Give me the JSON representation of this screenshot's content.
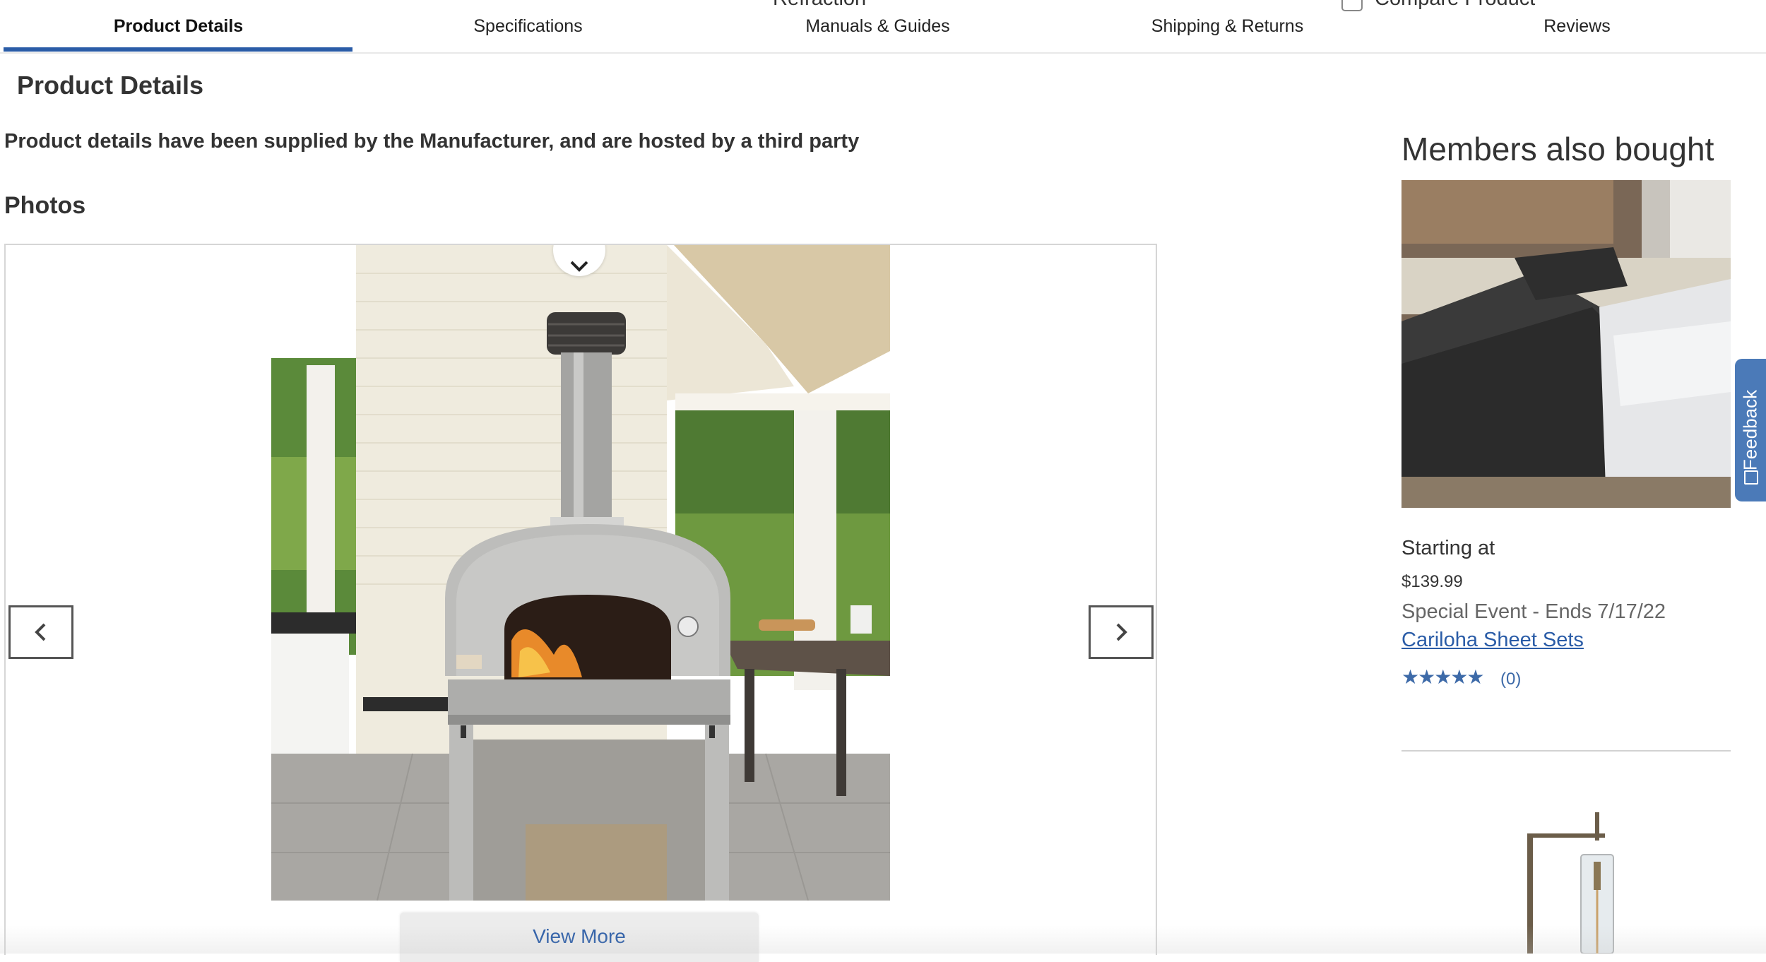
{
  "header": {
    "cut_off_left": "Refraction",
    "cut_off_right": "Compare Product",
    "tabs": [
      {
        "label": "Product Details",
        "active": true
      },
      {
        "label": "Specifications",
        "active": false
      },
      {
        "label": "Manuals & Guides",
        "active": false
      },
      {
        "label": "Shipping & Returns",
        "active": false
      },
      {
        "label": "Reviews",
        "active": false
      }
    ]
  },
  "main": {
    "section_title": "Product Details",
    "notice": "Product details have been supplied by the Manufacturer, and are hosted by a third party",
    "photos_heading": "Photos",
    "view_more_label": "View More"
  },
  "sidebar": {
    "title": "Members also bought",
    "products": [
      {
        "starting_label": "Starting at",
        "price": "$139.99",
        "event": "Special Event - Ends 7/17/22",
        "name": "Cariloha Sheet Sets",
        "rating_stars": "★★★★★",
        "review_count": "(0)"
      }
    ]
  },
  "feedback_label": "Feedback",
  "colors": {
    "accent": "#2a5ca7",
    "feedback_tab": "#4b7ab8",
    "star": "#3d6aa8"
  }
}
